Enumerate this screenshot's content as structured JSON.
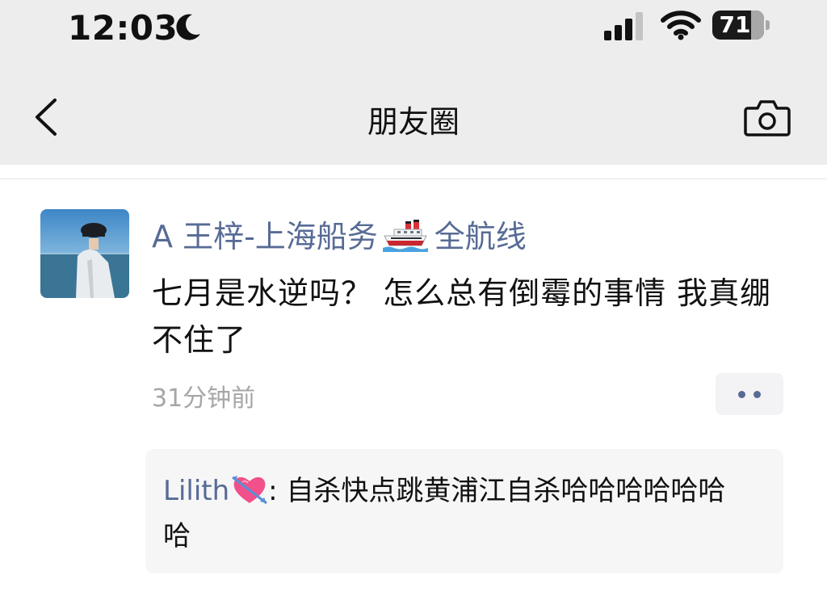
{
  "status_bar": {
    "time": "12:03",
    "battery_level": "71",
    "icons": [
      "moon-icon",
      "signal-icon",
      "wifi-icon",
      "battery-icon"
    ]
  },
  "nav": {
    "title": "朋友圈",
    "back_icon": "chevron-left-icon",
    "camera_icon": "camera-icon"
  },
  "post": {
    "author_prefix": "A 王梓-上海船务",
    "author_suffix": "全航线",
    "author_emoji": "ship-icon",
    "content": "七月是水逆吗？ 怎么总有倒霉的事情 我真绷不住了",
    "timestamp": "31分钟前",
    "more_icon": "more-dots-icon"
  },
  "comments": [
    {
      "user": "Lilith",
      "user_emoji": "heart-with-arrow-icon",
      "separator": ": ",
      "text": "自杀快点跳黄浦江自杀哈哈哈哈哈哈哈"
    }
  ],
  "colors": {
    "link_blue": "#576b95",
    "header_bg": "#ededed",
    "comment_bg": "#f6f6f6",
    "timestamp_grey": "#a6a6a6"
  }
}
